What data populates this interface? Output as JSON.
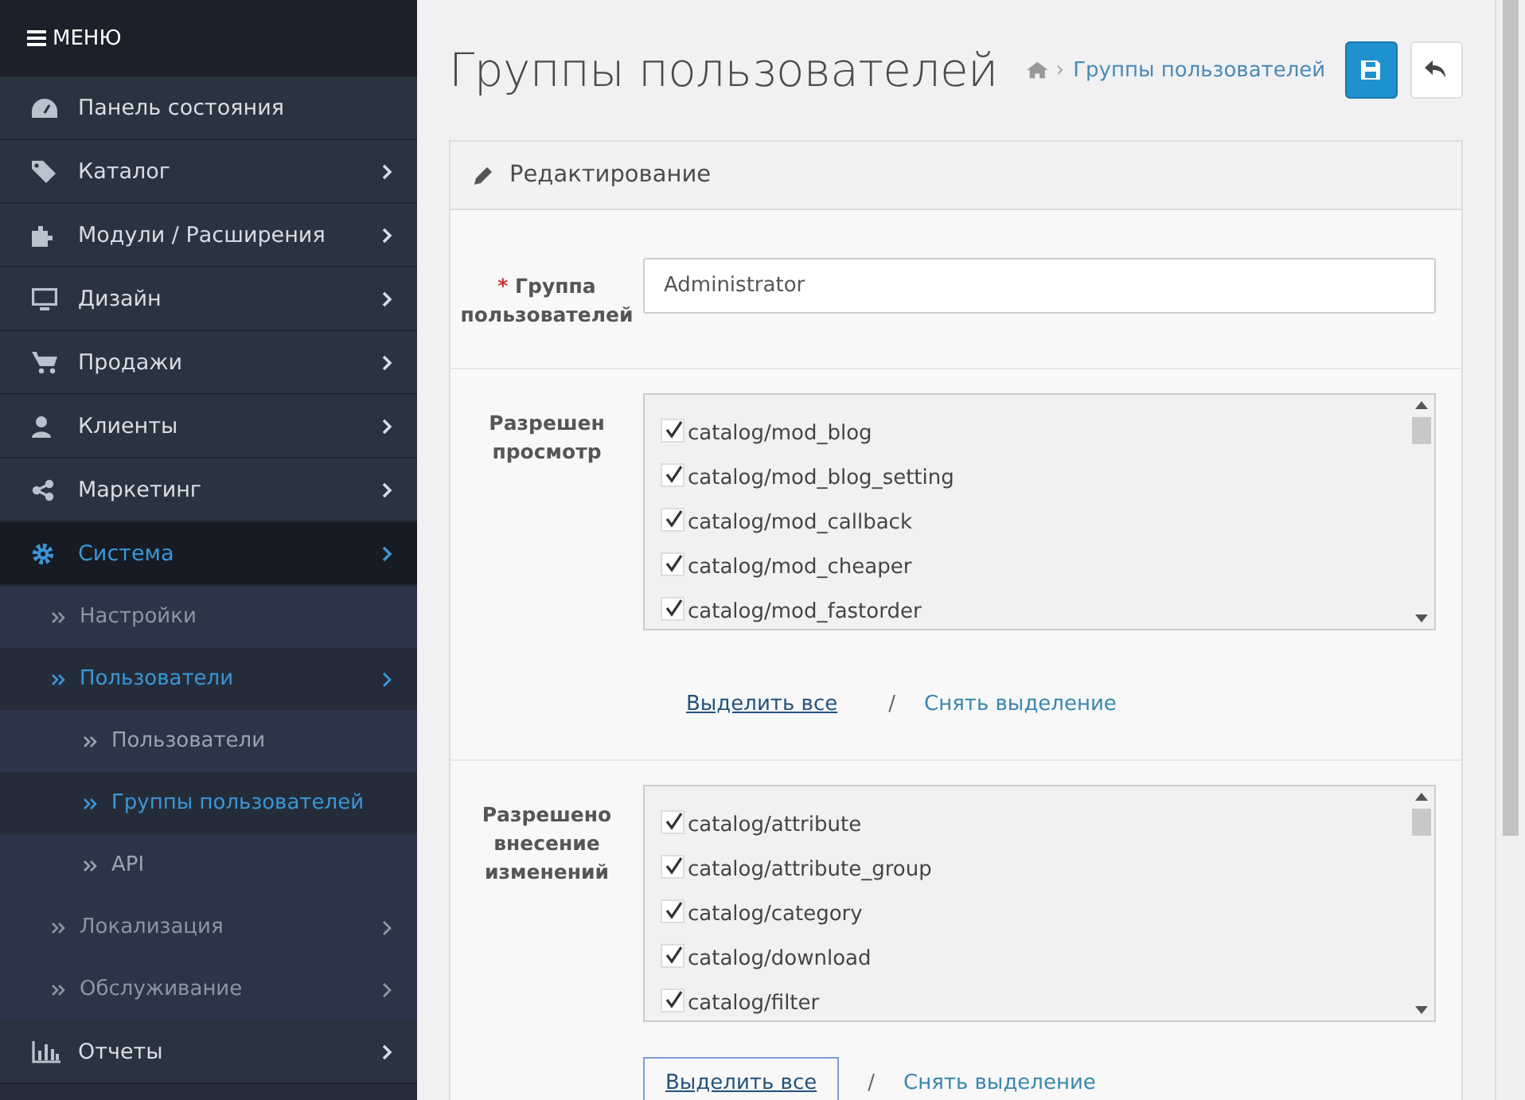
{
  "sidebar": {
    "header": "МЕНЮ",
    "items": [
      {
        "label": "Панель состояния",
        "expandable": false,
        "active": false
      },
      {
        "label": "Каталог",
        "expandable": true,
        "active": false
      },
      {
        "label": "Модули / Расширения",
        "expandable": true,
        "active": false
      },
      {
        "label": "Дизайн",
        "expandable": true,
        "active": false
      },
      {
        "label": "Продажи",
        "expandable": true,
        "active": false
      },
      {
        "label": "Клиенты",
        "expandable": true,
        "active": false
      },
      {
        "label": "Маркетинг",
        "expandable": true,
        "active": false
      },
      {
        "label": "Система",
        "expandable": true,
        "active": true,
        "children": [
          {
            "label": "Настройки",
            "expandable": false,
            "active": false
          },
          {
            "label": "Пользователи",
            "expandable": true,
            "active": true,
            "children": [
              {
                "label": "Пользователи",
                "active": false
              },
              {
                "label": "Группы пользователей",
                "active": true
              },
              {
                "label": "API",
                "active": false
              }
            ]
          },
          {
            "label": "Локализация",
            "expandable": true,
            "active": false
          },
          {
            "label": "Обслуживание",
            "expandable": true,
            "active": false
          }
        ]
      },
      {
        "label": "Отчеты",
        "expandable": true,
        "active": false
      }
    ]
  },
  "page": {
    "title": "Группы пользователей",
    "breadcrumb": [
      "Группы пользователей"
    ]
  },
  "panel": {
    "title": "Редактирование",
    "name_field": {
      "label": "Группа пользователей",
      "required_mark": "*",
      "value": "Administrator"
    },
    "permissions": [
      {
        "label": "Разрешен просмотр",
        "items": [
          {
            "label": "catalog/mod_blog",
            "checked": true
          },
          {
            "label": "catalog/mod_blog_setting",
            "checked": true
          },
          {
            "label": "catalog/mod_callback",
            "checked": true
          },
          {
            "label": "catalog/mod_cheaper",
            "checked": true
          },
          {
            "label": "catalog/mod_fastorder",
            "checked": true
          }
        ],
        "select_all": {
          "label": "Выделить все",
          "focused": false
        },
        "separator": "/",
        "deselect": "Снять выделение"
      },
      {
        "label": "Разрешено внесение изменений",
        "items": [
          {
            "label": "catalog/attribute",
            "checked": true
          },
          {
            "label": "catalog/attribute_group",
            "checked": true
          },
          {
            "label": "catalog/category",
            "checked": true
          },
          {
            "label": "catalog/download",
            "checked": true
          },
          {
            "label": "catalog/filter",
            "checked": true
          }
        ],
        "select_all": {
          "label": "Выделить все",
          "focused": true
        },
        "separator": "/",
        "deselect": "Снять выделение"
      }
    ]
  }
}
